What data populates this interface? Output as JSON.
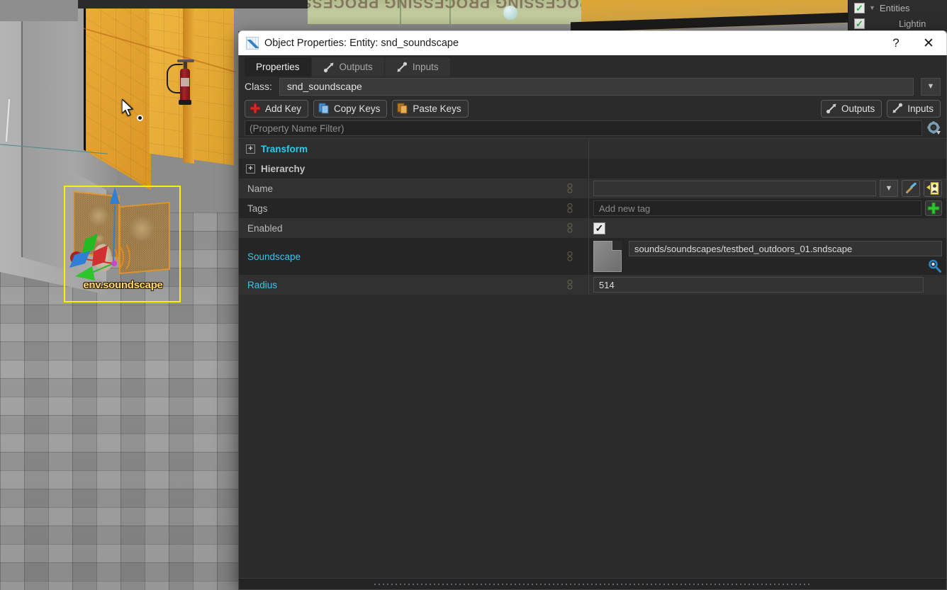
{
  "viewport": {
    "wall_text": "PROCESSING  PROCESSING  PROCESSING",
    "entity_label": "env.soundscape"
  },
  "outliner": {
    "items": [
      {
        "label": "Entities",
        "checked": true,
        "expandable": true
      },
      {
        "label": "Lightin",
        "checked": true,
        "expandable": false
      }
    ]
  },
  "dialog": {
    "title": "Object Properties: Entity: snd_soundscape",
    "window_icon": "hammer-grid-icon",
    "help_label": "?",
    "close_label": "✕",
    "tabs": [
      {
        "label": "Properties",
        "icon": "",
        "active": true
      },
      {
        "label": "Outputs",
        "icon": "output-arrow-icon",
        "active": false
      },
      {
        "label": "Inputs",
        "icon": "input-arrow-icon",
        "active": false
      }
    ],
    "class_row": {
      "label": "Class:",
      "value": "snd_soundscape",
      "dropdown_icon": "chevron-down-icon"
    },
    "toolbar": {
      "add_key": "Add Key",
      "copy_keys": "Copy Keys",
      "paste_keys": "Paste Keys",
      "outputs": "Outputs",
      "inputs": "Inputs"
    },
    "filter": {
      "placeholder": "(Property Name Filter)",
      "gear_icon": "gear-icon"
    },
    "properties": [
      {
        "kind": "group",
        "name": "Transform",
        "color": "cyan",
        "expander": "+"
      },
      {
        "kind": "group",
        "name": "Hierarchy",
        "color": "gray",
        "expander": "+"
      },
      {
        "kind": "combo",
        "name": "Name",
        "value": "",
        "link": false
      },
      {
        "kind": "tag",
        "name": "Tags",
        "value": "",
        "placeholder": "Add new tag",
        "link": false
      },
      {
        "kind": "bool",
        "name": "Enabled",
        "value": true,
        "link": false
      },
      {
        "kind": "file",
        "name": "Soundscape",
        "value": "sounds/soundscapes/testbed_outdoors_01.sndscape",
        "link": true
      },
      {
        "kind": "text",
        "name": "Radius",
        "value": "514",
        "link": true
      }
    ]
  }
}
